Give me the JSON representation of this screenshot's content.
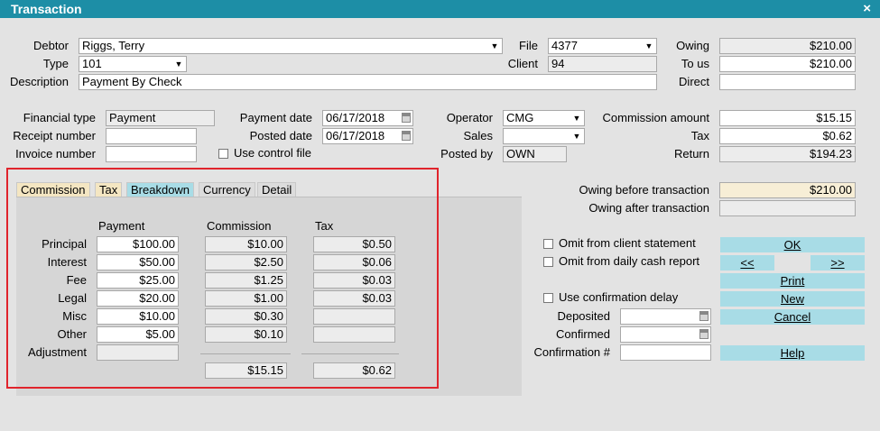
{
  "window": {
    "title": "Transaction",
    "close": "×"
  },
  "header": {
    "debtor_label": "Debtor",
    "debtor_value": "Riggs, Terry",
    "type_label": "Type",
    "type_value": "101",
    "description_label": "Description",
    "description_value": "Payment By Check",
    "file_label": "File",
    "file_value": "4377",
    "client_label": "Client",
    "client_value": "94",
    "owing_label": "Owing",
    "owing_value": "$210.00",
    "tous_label": "To us",
    "tous_value": "$210.00",
    "direct_label": "Direct",
    "direct_value": ""
  },
  "details": {
    "financial_type_label": "Financial type",
    "financial_type_value": "Payment",
    "receipt_label": "Receipt number",
    "receipt_value": "",
    "invoice_label": "Invoice number",
    "invoice_value": "",
    "payment_date_label": "Payment date",
    "payment_date_value": "06/17/2018",
    "posted_date_label": "Posted date",
    "posted_date_value": "06/17/2018",
    "use_control_file_label": "Use control file",
    "operator_label": "Operator",
    "operator_value": "CMG",
    "sales_label": "Sales",
    "sales_value": "",
    "posted_by_label": "Posted by",
    "posted_by_value": "OWN",
    "commission_amount_label": "Commission amount",
    "commission_amount_value": "$15.15",
    "tax_label": "Tax",
    "tax_value": "$0.62",
    "return_label": "Return",
    "return_value": "$194.23"
  },
  "tabs": [
    {
      "label": "Commission",
      "active": false,
      "color": "#f4e6c2"
    },
    {
      "label": "Tax",
      "active": false,
      "color": "#f4e6c2"
    },
    {
      "label": "Breakdown",
      "active": true,
      "color": "#a8dce6"
    },
    {
      "label": "Currency",
      "active": false,
      "color": "#dcdcdc"
    },
    {
      "label": "Detail",
      "active": false,
      "color": "#dcdcdc"
    }
  ],
  "breakdown": {
    "col_payment": "Payment",
    "col_commission": "Commission",
    "col_tax": "Tax",
    "rows": [
      {
        "label": "Principal",
        "payment": "$100.00",
        "commission": "$10.00",
        "tax": "$0.50"
      },
      {
        "label": "Interest",
        "payment": "$50.00",
        "commission": "$2.50",
        "tax": "$0.06"
      },
      {
        "label": "Fee",
        "payment": "$25.00",
        "commission": "$1.25",
        "tax": "$0.03"
      },
      {
        "label": "Legal",
        "payment": "$20.00",
        "commission": "$1.00",
        "tax": "$0.03"
      },
      {
        "label": "Misc",
        "payment": "$10.00",
        "commission": "$0.30",
        "tax": ""
      },
      {
        "label": "Other",
        "payment": "$5.00",
        "commission": "$0.10",
        "tax": ""
      },
      {
        "label": "Adjustment",
        "payment": "",
        "commission": "",
        "tax": ""
      }
    ],
    "total_commission": "$15.15",
    "total_tax": "$0.62"
  },
  "summary": {
    "owing_before_label": "Owing before transaction",
    "owing_before_value": "$210.00",
    "owing_after_label": "Owing after transaction",
    "owing_after_value": ""
  },
  "options": {
    "omit_client_label": "Omit from client statement",
    "omit_cash_label": "Omit from daily cash report",
    "use_confirmation_label": "Use confirmation delay",
    "deposited_label": "Deposited",
    "deposited_value": "",
    "confirmed_label": "Confirmed",
    "confirmed_value": "",
    "confirmation_no_label": "Confirmation #",
    "confirmation_no_value": ""
  },
  "buttons": {
    "ok": "OK",
    "prev": "<<",
    "next": ">>",
    "print": "Print",
    "new": "New",
    "cancel": "Cancel",
    "help": "Help"
  }
}
